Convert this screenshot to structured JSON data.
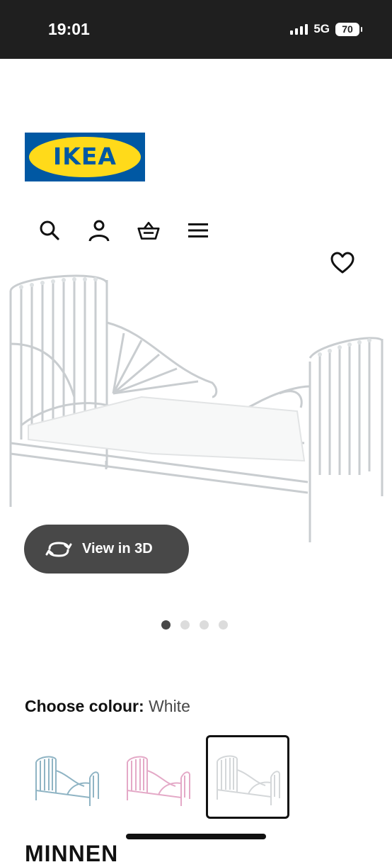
{
  "status_bar": {
    "time": "19:01",
    "network": "5G",
    "battery": "70"
  },
  "logo": {
    "text": "IKEA",
    "registered": "®"
  },
  "nav": {
    "icons": [
      "search-icon",
      "user-icon",
      "basket-icon",
      "menu-icon"
    ]
  },
  "product": {
    "view_3d_label": "View in 3D",
    "image_count": 4,
    "active_image": 1,
    "colour_label": "Choose colour:",
    "colour_value": "White",
    "colours": [
      {
        "name": "light blue",
        "color": "#8fb4c4",
        "selected": false
      },
      {
        "name": "pink",
        "color": "#e4a9c7",
        "selected": false
      },
      {
        "name": "white",
        "color": "#d9d9d9",
        "selected": true
      }
    ],
    "name": "MINNEN"
  },
  "colors": {
    "status_bar_bg": "#1f1f1f",
    "ikea_blue": "#0058a3",
    "ikea_yellow": "#ffda1a",
    "button_dark": "#484848"
  }
}
